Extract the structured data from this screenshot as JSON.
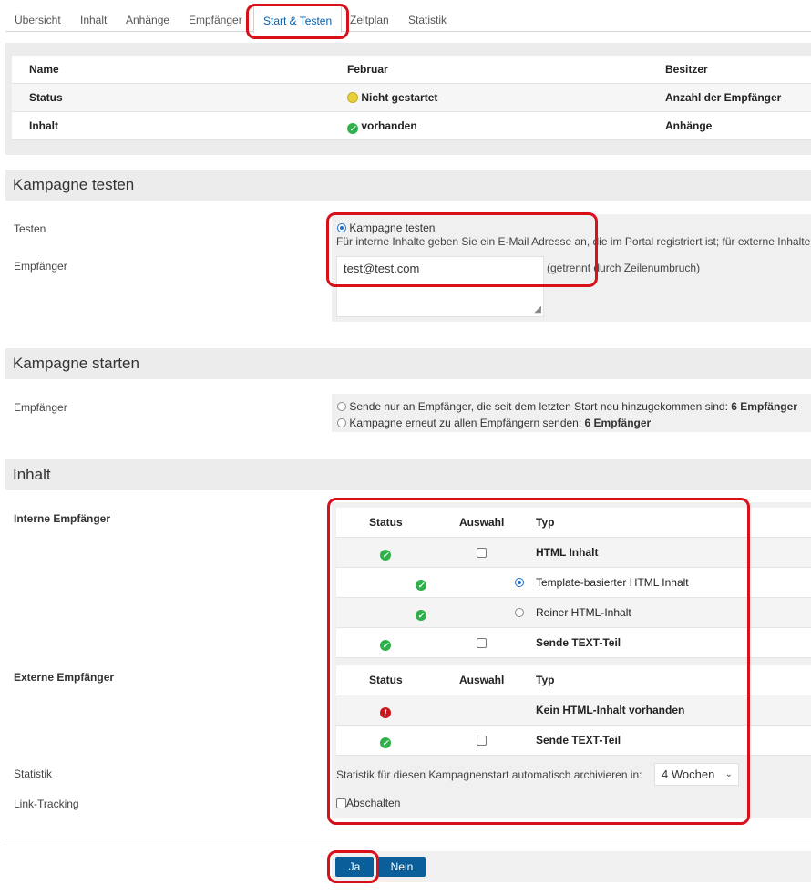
{
  "tabs": [
    "Übersicht",
    "Inhalt",
    "Anhänge",
    "Empfänger",
    "Start & Testen",
    "Zeitplan",
    "Statistik"
  ],
  "summary": {
    "headers": [
      "Name",
      "Februar",
      "Besitzer"
    ],
    "status_label": "Status",
    "status_value": "Nicht gestartet",
    "recipients_count_label": "Anzahl der Empfänger",
    "content_label": "Inhalt",
    "content_value": "vorhanden",
    "attachments_label": "Anhänge"
  },
  "test": {
    "title": "Kampagne testen",
    "testen_label": "Testen",
    "radio_label": "Kampagne testen",
    "hint": "Für interne Inhalte geben Sie ein E-Mail Adresse an, die im Portal registriert ist; für externe Inhalte",
    "recipients_label": "Empfänger",
    "email_value": "test@test.com",
    "separator_note": "(getrennt durch Zeilenumbruch)"
  },
  "start": {
    "title": "Kampagne starten",
    "recipients_label": "Empfänger",
    "opt1_text": "Sende nur an Empfänger, die seit dem letzten Start neu hinzugekommen sind:",
    "opt1_count": "6 Empfänger",
    "opt2_text": "Kampagne erneut zu allen Empfängern senden:",
    "opt2_count": "6 Empfänger"
  },
  "content": {
    "title": "Inhalt",
    "intern_label": "Interne Empfänger",
    "extern_label": "Externe Empfänger",
    "col_status": "Status",
    "col_auswahl": "Auswahl",
    "col_typ": "Typ",
    "intern_rows": [
      "HTML Inhalt",
      "Template-basierter HTML Inhalt",
      "Reiner HTML-Inhalt",
      "Sende TEXT-Teil"
    ],
    "extern_rows": [
      "Kein HTML-Inhalt vorhanden",
      "Sende TEXT-Teil"
    ],
    "statistik_label": "Statistik",
    "statistik_text": "Statistik für diesen Kampagnenstart automatisch archivieren in:",
    "statistik_value": "4 Wochen",
    "linktracking_label": "Link-Tracking",
    "linktracking_text": "Abschalten"
  },
  "buttons": {
    "yes": "Ja",
    "no": "Nein"
  },
  "colors": {
    "accent": "#0b5ea8",
    "highlight": "#d8101a",
    "ok": "#2eb04a",
    "error": "#c8161d",
    "warn": "#e9cf3a"
  }
}
